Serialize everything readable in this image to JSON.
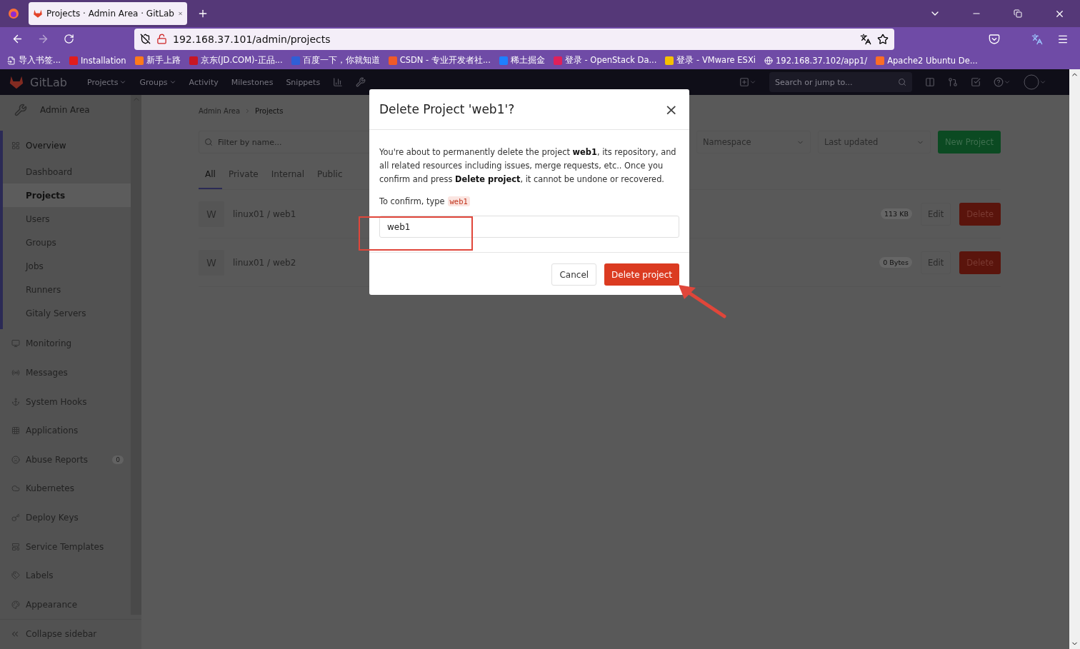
{
  "browser": {
    "tab_title": "Projects · Admin Area · GitLab",
    "url": "192.168.37.101/admin/projects",
    "bookmarks": [
      "导入书签...",
      "Installation",
      "新手上路",
      "京东(JD.COM)-正品...",
      "百度一下，你就知道",
      "CSDN - 专业开发者社...",
      "稀土掘金",
      "登录 - OpenStack Da...",
      "登录 - VMware ESXi",
      "192.168.37.102/app1/",
      "Apache2 Ubuntu De..."
    ]
  },
  "navbar": {
    "brand": "GitLab",
    "items": [
      {
        "label": "Projects",
        "dropdown": true
      },
      {
        "label": "Groups",
        "dropdown": true
      },
      {
        "label": "Activity",
        "dropdown": false
      },
      {
        "label": "Milestones",
        "dropdown": false
      },
      {
        "label": "Snippets",
        "dropdown": false
      }
    ],
    "search_placeholder": "Search or jump to..."
  },
  "sidebar": {
    "title": "Admin Area",
    "items": [
      {
        "label": "Overview",
        "selected": false,
        "expanded": true,
        "children": [
          {
            "label": "Dashboard",
            "selected": false
          },
          {
            "label": "Projects",
            "selected": true
          },
          {
            "label": "Users",
            "selected": false
          },
          {
            "label": "Groups",
            "selected": false
          },
          {
            "label": "Jobs",
            "selected": false
          },
          {
            "label": "Runners",
            "selected": false
          },
          {
            "label": "Gitaly Servers",
            "selected": false
          }
        ]
      },
      {
        "label": "Monitoring",
        "selected": false,
        "expanded": false
      },
      {
        "label": "Messages",
        "selected": false,
        "expanded": false
      },
      {
        "label": "System Hooks",
        "selected": false,
        "expanded": false
      },
      {
        "label": "Applications",
        "selected": false,
        "expanded": false
      },
      {
        "label": "Abuse Reports",
        "selected": false,
        "expanded": false,
        "badge": "0"
      },
      {
        "label": "Kubernetes",
        "selected": false,
        "expanded": false
      },
      {
        "label": "Deploy Keys",
        "selected": false,
        "expanded": false
      },
      {
        "label": "Service Templates",
        "selected": false,
        "expanded": false
      },
      {
        "label": "Labels",
        "selected": false,
        "expanded": false
      },
      {
        "label": "Appearance",
        "selected": false,
        "expanded": false
      }
    ],
    "collapse": "Collapse sidebar"
  },
  "breadcrumbs": [
    "Admin Area",
    "Projects"
  ],
  "filter": {
    "placeholder": "Filter by name..."
  },
  "namespace_select": "Namespace",
  "sort_select": "Last updated",
  "new_project": "New Project",
  "tabs": [
    {
      "label": "All",
      "selected": true
    },
    {
      "label": "Private",
      "selected": false
    },
    {
      "label": "Internal",
      "selected": false
    },
    {
      "label": "Public",
      "selected": false
    }
  ],
  "projects": [
    {
      "avatar": "W",
      "name": "linux01 / web1",
      "size": "113 KB",
      "edit": "Edit",
      "delete": "Delete"
    },
    {
      "avatar": "W",
      "name": "linux01 / web2",
      "size": "0 Bytes",
      "edit": "Edit",
      "delete": "Delete"
    }
  ],
  "modal": {
    "title": "Delete Project 'web1'?",
    "close": "×",
    "message": "You're about to permanently delete the project **web1**, its repository, and all related resources including issues, merge requests, etc.. Once you confirm and press **Delete project**, it cannot be undone or recovered.",
    "confirm_prompt": "To confirm, type",
    "confirm_code": "web1",
    "input_value": "web1",
    "cancel": "Cancel",
    "submit": "Delete project"
  }
}
